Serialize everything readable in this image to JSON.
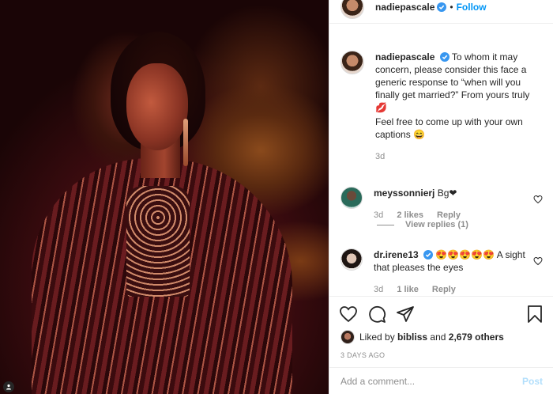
{
  "post": {
    "username": "nadiepascale",
    "follow_label": "Follow",
    "separator": "•"
  },
  "caption": {
    "username": "nadiepascale",
    "text": "To whom it may concern, please consider this face a generic response to “when will you finally get married?” From yours truly 💋",
    "text2": "Feel free to come up with your own captions 😄",
    "time": "3d"
  },
  "comments": [
    {
      "username": "meyssonnierj",
      "text": "Bg❤",
      "time": "3d",
      "likes": "2 likes",
      "reply_label": "Reply",
      "view_replies": "View replies (1)"
    },
    {
      "username": "dr.irene13",
      "text": "😍😍😍😍😍 A sight that pleases the eyes",
      "time": "3d",
      "likes": "1 like",
      "reply_label": "Reply"
    }
  ],
  "likes": {
    "prefix": "Liked by",
    "user": "bibliss",
    "and": "and",
    "others": "2,679 others"
  },
  "date": "3 DAYS AGO",
  "add_comment": {
    "placeholder": "Add a comment...",
    "post_label": "Post"
  },
  "colors": {
    "accent": "#0095f6",
    "verified": "#3897f0",
    "heart_red": "#ed4956"
  },
  "icons": [
    "heart-icon",
    "comment-icon",
    "share-icon",
    "bookmark-icon",
    "verified-icon",
    "user-tag-icon"
  ]
}
